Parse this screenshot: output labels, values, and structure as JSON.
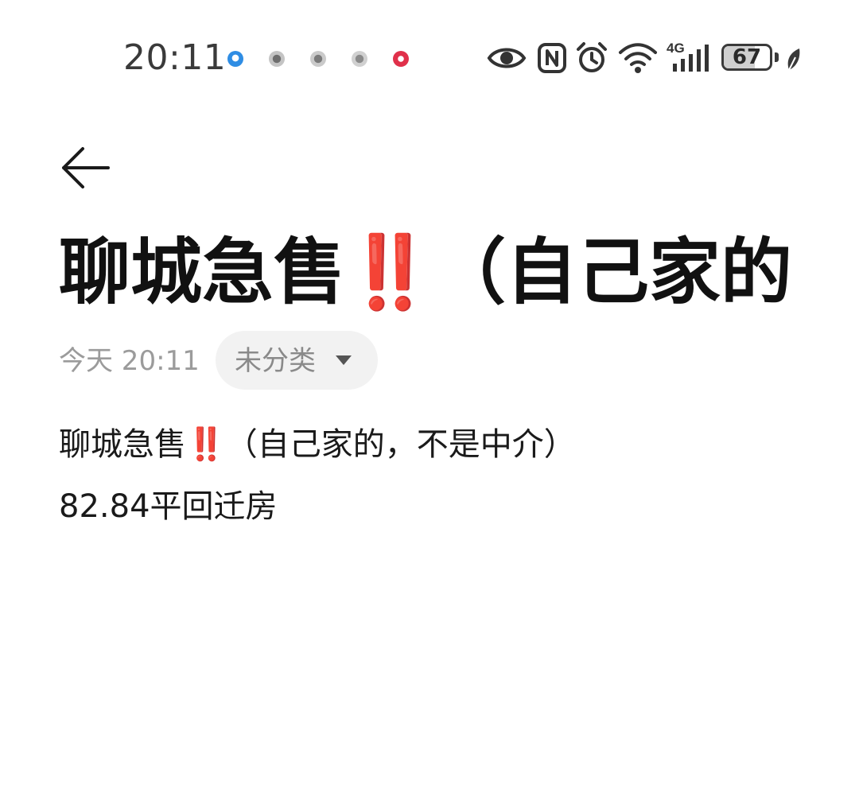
{
  "status_bar": {
    "time": "20:11",
    "battery_level": "67",
    "notification_icons": [
      "weather-icon",
      "app-icon",
      "app-icon",
      "app-icon",
      "red-app-icon"
    ],
    "system_icons": [
      "eye-icon",
      "nfc-icon",
      "alarm-icon",
      "wifi-icon",
      "signal-icon",
      "leaf-icon"
    ],
    "network_label": "4G"
  },
  "toolbar": {
    "back_icon": "back-arrow-icon"
  },
  "note": {
    "title": "聊城急售‼️（自己家的",
    "date": "今天 20:11",
    "category": "未分类",
    "body_lines": [
      "聊城急售‼️（自己家的，不是中介）",
      "82.84平回迁房"
    ]
  },
  "colors": {
    "background": "#ffffff",
    "title_text": "#111111",
    "meta_text": "#9b9b9b",
    "chip_background": "#f2f2f2",
    "emoji_red": "#e02020"
  }
}
